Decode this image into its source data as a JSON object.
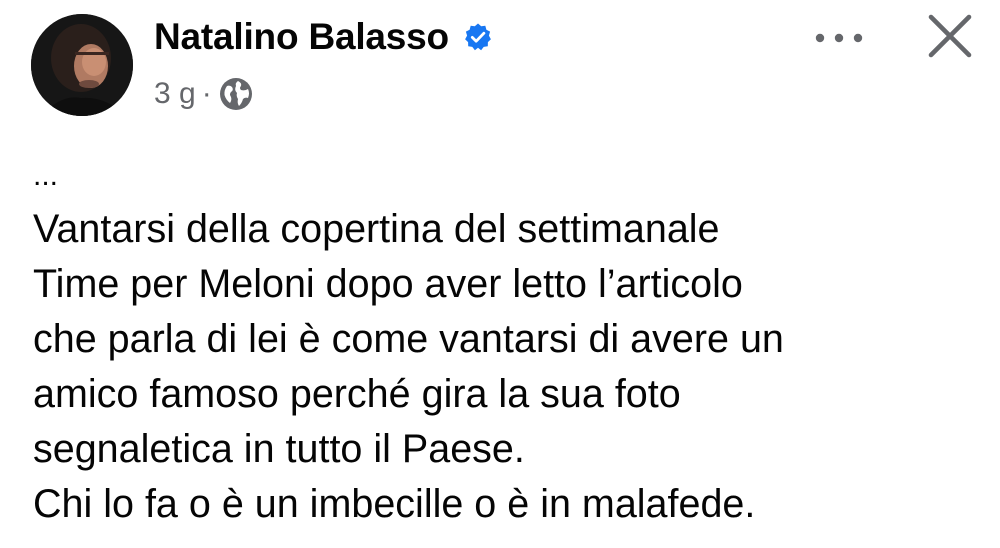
{
  "post": {
    "author_name": "Natalino Balasso",
    "verified": true,
    "timestamp": "3 g",
    "separator": "·",
    "audience_icon": "globe-icon",
    "more_icon": "more-horizontal-icon",
    "close_icon": "close-icon",
    "body": {
      "ellipsis": "...",
      "lines": [
        "Vantarsi della copertina del settimanale",
        "Time per Meloni dopo aver letto l’articolo",
        "che parla di lei è come vantarsi di avere un",
        "amico famoso perché gira la sua foto",
        "segnaletica in tutto il Paese.",
        "Chi lo fa o è un imbecille o è in malafede."
      ]
    }
  },
  "colors": {
    "text_primary": "#050505",
    "text_secondary": "#65676b",
    "verified_blue": "#1877f2",
    "background": "#ffffff"
  }
}
